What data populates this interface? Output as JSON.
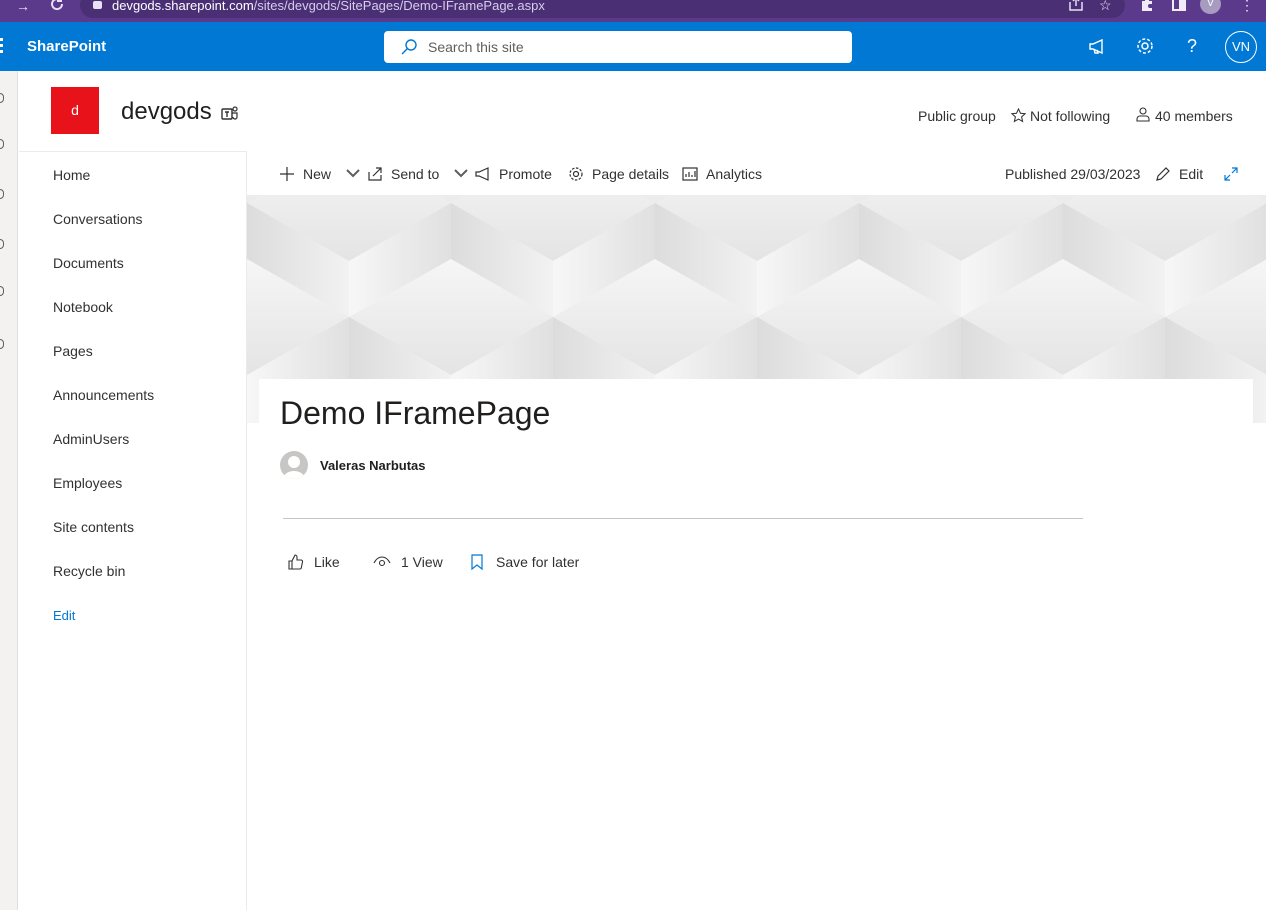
{
  "browser": {
    "url_host": "devgods.sharepoint.com",
    "url_path": "/sites/devgods/SitePages/Demo-IFramePage.aspx",
    "profile_initial": "V"
  },
  "suite": {
    "brand": "SharePoint",
    "search_placeholder": "Search this site",
    "user_initials": "VN",
    "icons": [
      "megaphone-icon",
      "gear-icon",
      "help-icon"
    ]
  },
  "site": {
    "logo_letter": "d",
    "title": "devgods",
    "privacy": "Public group",
    "follow": "Not following",
    "members": "40 members",
    "accent": "#e8121b"
  },
  "nav": {
    "items": [
      "Home",
      "Conversations",
      "Documents",
      "Notebook",
      "Pages",
      "Announcements",
      "AdminUsers",
      "Employees",
      "Site contents",
      "Recycle bin"
    ],
    "edit": "Edit"
  },
  "commands": {
    "new": "New",
    "send_to": "Send to",
    "promote": "Promote",
    "page_details": "Page details",
    "analytics": "Analytics",
    "published": "Published 29/03/2023",
    "edit": "Edit"
  },
  "page": {
    "title": "Demo IFramePage",
    "author": "Valeras Narbutas",
    "like": "Like",
    "views": "1 View",
    "save": "Save for later"
  },
  "colors": {
    "suite_bar": "#0078d4",
    "browser_bar": "#5b3a8c"
  }
}
